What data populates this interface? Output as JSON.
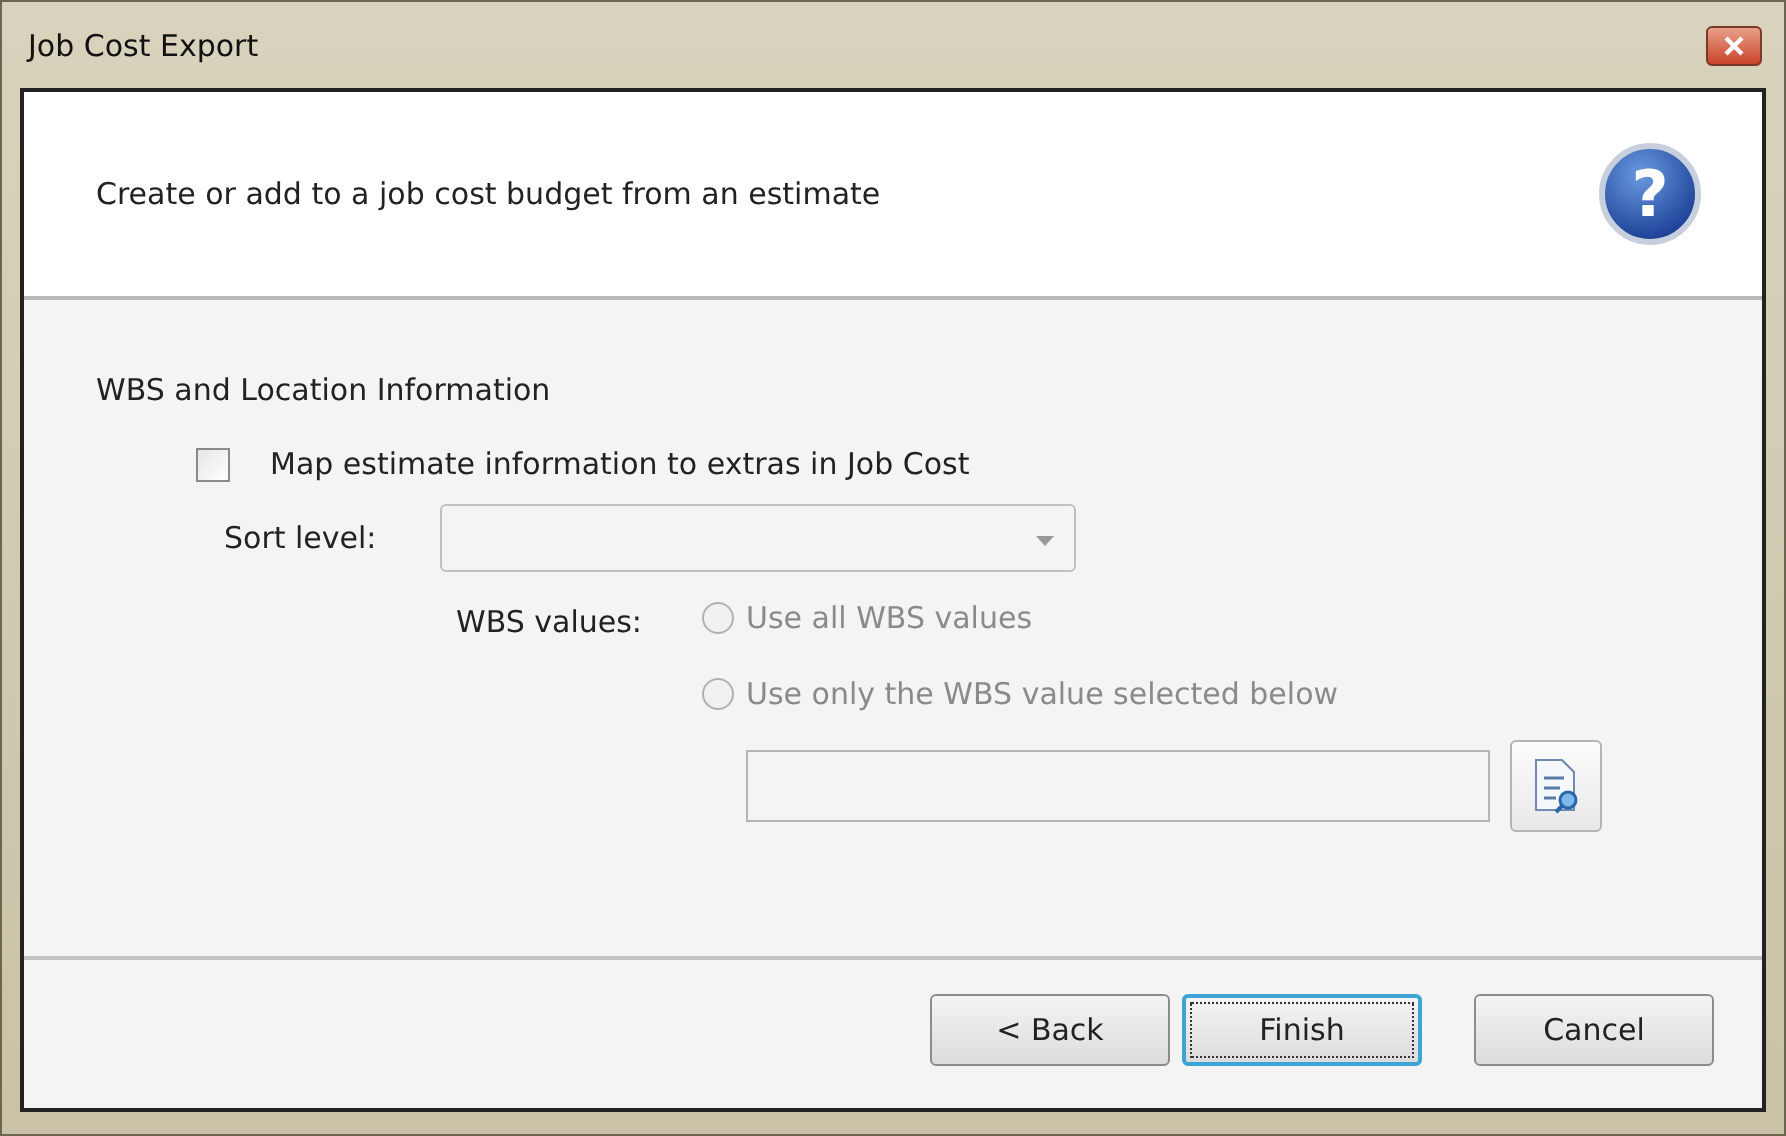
{
  "window": {
    "title": "Job Cost Export"
  },
  "header": {
    "text": "Create or add to a job cost budget from an estimate",
    "help_icon": "?"
  },
  "section": {
    "title": "WBS and Location Information"
  },
  "map_checkbox": {
    "label": "Map estimate information to extras in Job Cost",
    "checked": false
  },
  "sort_level": {
    "label": "Sort level:",
    "disabled": true
  },
  "wbs_values": {
    "label": "WBS values:",
    "options": [
      {
        "label": "Use all WBS values",
        "selected": false,
        "disabled": true
      },
      {
        "label": "Use only the WBS value selected below",
        "selected": false,
        "disabled": true
      }
    ]
  },
  "wbs_field": {
    "disabled": true
  },
  "buttons": [
    {
      "label": "< Back",
      "default": false
    },
    {
      "label": "Finish",
      "default": true
    },
    {
      "label": "Cancel",
      "default": false
    }
  ]
}
